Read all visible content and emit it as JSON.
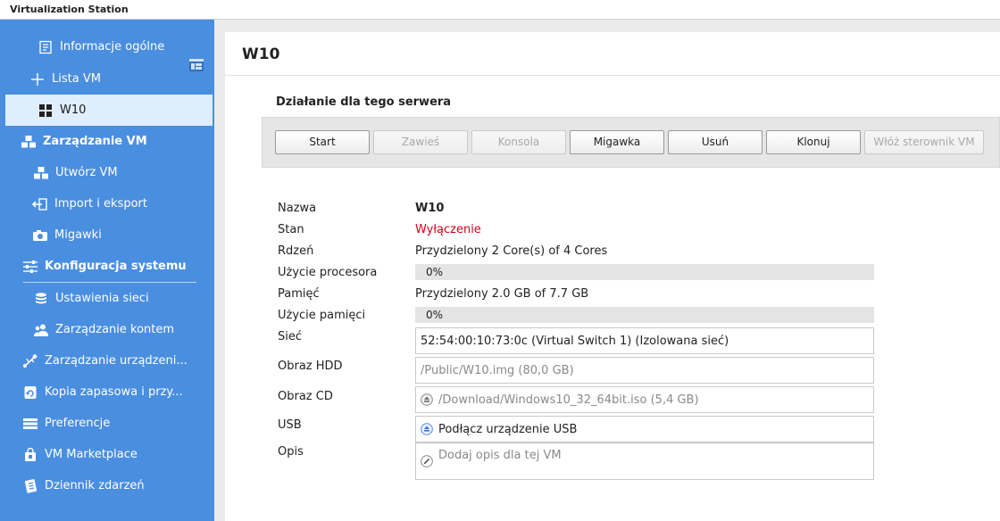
{
  "window": {
    "title": "Virtualization Station"
  },
  "sidebar": {
    "items": [
      {
        "label": "Informacje ogólne"
      },
      {
        "label": "Lista VM"
      },
      {
        "label": "W10"
      },
      {
        "label": "Zarządzanie VM"
      },
      {
        "label": "Utwórz VM"
      },
      {
        "label": "Import i eksport"
      },
      {
        "label": "Migawki"
      },
      {
        "label": "Konfiguracja systemu"
      },
      {
        "label": "Ustawienia sieci"
      },
      {
        "label": "Zarządzanie kontem"
      },
      {
        "label": "Zarządzanie urządzeni..."
      },
      {
        "label": "Kopia zapasowa i przy..."
      },
      {
        "label": "Preferencje"
      },
      {
        "label": "VM Marketplace"
      },
      {
        "label": "Dziennik zdarzeń"
      }
    ]
  },
  "main": {
    "title": "W10",
    "actions_title": "Działanie dla tego serwera",
    "buttons": [
      {
        "label": "Start",
        "enabled": true
      },
      {
        "label": "Zawieś",
        "enabled": false
      },
      {
        "label": "Konsola",
        "enabled": false
      },
      {
        "label": "Migawka",
        "enabled": true
      },
      {
        "label": "Usuń",
        "enabled": true
      },
      {
        "label": "Klonuj",
        "enabled": true
      },
      {
        "label": "Włóż sterownik VM",
        "enabled": false
      }
    ],
    "props": {
      "name_label": "Nazwa",
      "name_value": "W10",
      "state_label": "Stan",
      "state_value": "Wyłączenie",
      "core_label": "Rdzeń",
      "core_value": "Przydzielony 2 Core(s) of 4 Cores",
      "cpu_label": "Użycie procesora",
      "cpu_value": "0%",
      "cpu_percent": 0,
      "mem_label": "Pamięć",
      "mem_value": "Przydzielony 2.0 GB of 7.7 GB",
      "memuse_label": "Użycie pamięci",
      "memuse_value": "0%",
      "memuse_percent": 0,
      "net_label": "Sieć",
      "net_value": "52:54:00:10:73:0c (Virtual Switch 1) (Izolowana sieć)",
      "hdd_label": "Obraz HDD",
      "hdd_value": "/Public/W10.img (80,0 GB)",
      "cd_label": "Obraz CD",
      "cd_value": "/Download/Windows10_32_64bit.iso (5,4 GB)",
      "usb_label": "USB",
      "usb_value": "Podłącz urządzenie USB",
      "desc_label": "Opis",
      "desc_placeholder": "Dodaj opis dla tej VM"
    }
  },
  "colors": {
    "sidebar": "#4a8ee0",
    "selected": "#dfeefc",
    "state_off": "#d0021b"
  }
}
